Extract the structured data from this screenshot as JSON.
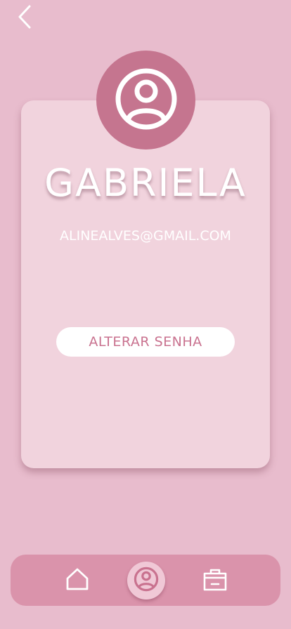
{
  "header": {
    "back_icon": "chevron-left-icon"
  },
  "profile": {
    "avatar_icon": "user-circle-icon",
    "name": "GABRIELA",
    "email": "ALINEALVES@GMAIL.COM",
    "change_password_label": "ALTERAR SENHA"
  },
  "bottom_nav": {
    "items": [
      {
        "icon": "home-icon",
        "active": false
      },
      {
        "icon": "user-circle-icon",
        "active": true
      },
      {
        "icon": "shopping-bag-icon",
        "active": false
      }
    ]
  },
  "colors": {
    "background": "#e8bccd",
    "card": "#f1d3dd",
    "avatar": "#c5758f",
    "accent_text": "#c9728f",
    "nav_bar": "#da93ab",
    "nav_active": "#f0c8d6"
  }
}
